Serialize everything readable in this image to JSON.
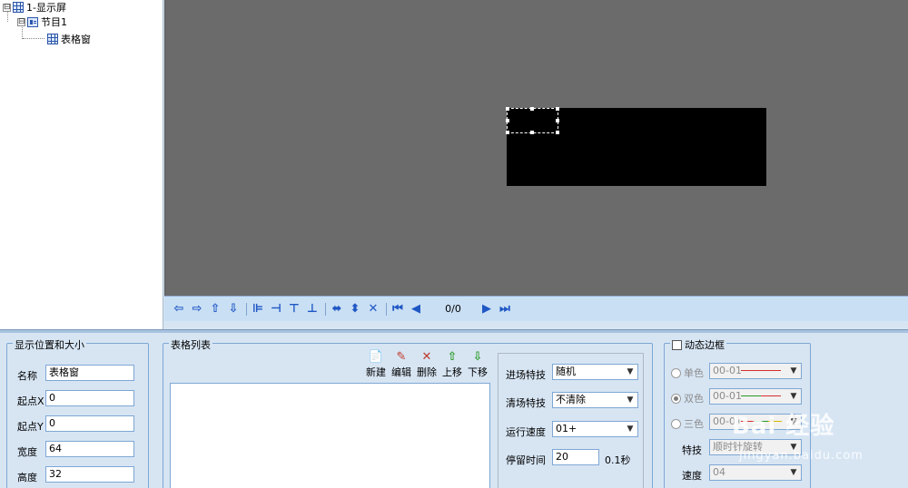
{
  "tree": {
    "root_label": "1-显示屏",
    "program_label": "节目1",
    "window_label": "表格窗",
    "root_expander": "⊟",
    "program_expander": "⊟"
  },
  "navbar": {
    "counter": "0/0",
    "icons": [
      "arrow-left-icon",
      "arrow-right-icon",
      "arrow-up-icon",
      "arrow-down-icon",
      "align-left-icon",
      "align-right-icon",
      "align-top-icon",
      "align-bottom-icon",
      "expand-horizontal-icon",
      "expand-vertical-icon",
      "expand-full-icon",
      "first-page-icon",
      "prev-page-icon",
      "next-page-icon",
      "last-page-icon"
    ]
  },
  "position_group": {
    "legend": "显示位置和大小",
    "name_label": "名称",
    "name_value": "表格窗",
    "x_label": "起点X",
    "x_value": "0",
    "y_label": "起点Y",
    "y_value": "0",
    "width_label": "宽度",
    "width_value": "64",
    "height_label": "高度",
    "height_value": "32"
  },
  "table_group": {
    "legend": "表格列表",
    "new_label": "新建",
    "edit_label": "编辑",
    "delete_label": "删除",
    "up_label": "上移",
    "down_label": "下移"
  },
  "effects": {
    "enter_label": "进场特技",
    "enter_value": "随机",
    "clear_label": "清场特技",
    "clear_value": "不清除",
    "speed_label": "运行速度",
    "speed_value": "01+",
    "stay_label": "停留时间",
    "stay_value": "20",
    "stay_unit": "0.1秒"
  },
  "border_group": {
    "legend": "动态边框",
    "single_label": "单色",
    "single_value": "00-01",
    "double_label": "双色",
    "double_value": "00-01",
    "triple_label": "三色",
    "triple_value": "00-01",
    "effect_label": "特技",
    "effect_value": "顺时针旋转",
    "speed_label": "速度",
    "speed_value": "04"
  },
  "watermark": {
    "brand": "Bai 经验",
    "url": "jingyan.baidu.com"
  },
  "colors": {
    "canvas": "#6b6b6b",
    "screen": "#000000",
    "panel": "#d7e5f3",
    "toolbar": "#c9dff4",
    "accent": "#1f57c4"
  }
}
